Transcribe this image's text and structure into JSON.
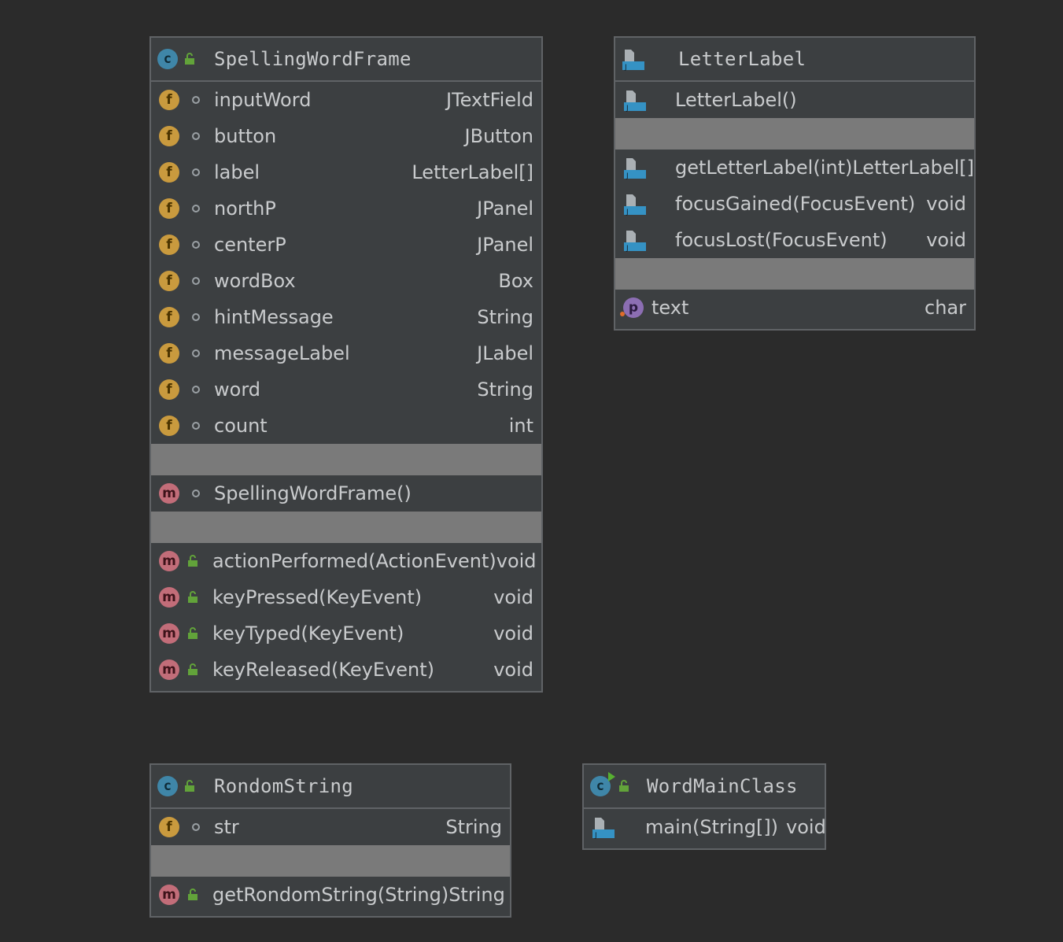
{
  "classes": {
    "spelling": {
      "name": "SpellingWordFrame",
      "fields": [
        {
          "name": "inputWord",
          "type": "JTextField"
        },
        {
          "name": "button",
          "type": "JButton"
        },
        {
          "name": "label",
          "type": "LetterLabel[]"
        },
        {
          "name": "northP",
          "type": "JPanel"
        },
        {
          "name": "centerP",
          "type": "JPanel"
        },
        {
          "name": "wordBox",
          "type": "Box"
        },
        {
          "name": "hintMessage",
          "type": "String"
        },
        {
          "name": "messageLabel",
          "type": "JLabel"
        },
        {
          "name": "word",
          "type": "String"
        },
        {
          "name": "count",
          "type": "int"
        }
      ],
      "constructor": "SpellingWordFrame()",
      "methods": [
        {
          "name": "actionPerformed(ActionEvent)",
          "type": "void"
        },
        {
          "name": "keyPressed(KeyEvent)",
          "type": "void"
        },
        {
          "name": "keyTyped(KeyEvent)",
          "type": "void"
        },
        {
          "name": "keyReleased(KeyEvent)",
          "type": "void"
        }
      ]
    },
    "letterlabel": {
      "name": "LetterLabel",
      "constructor": "LetterLabel()",
      "methods": [
        {
          "name": "getLetterLabel(int)",
          "type": "LetterLabel[]"
        },
        {
          "name": "focusGained(FocusEvent)",
          "type": "void"
        },
        {
          "name": "focusLost(FocusEvent)",
          "type": "void"
        }
      ],
      "property": {
        "name": "text",
        "type": "char"
      }
    },
    "rondom": {
      "name": "RondomString",
      "field": {
        "name": "str",
        "type": "String"
      },
      "method": {
        "name": "getRondomString(String)",
        "type": "String"
      }
    },
    "wordmain": {
      "name": "WordMainClass",
      "method": {
        "name": "main(String[])",
        "type": "void"
      }
    }
  },
  "icons": {
    "field": "field-icon",
    "method": "method-icon",
    "class": "class-icon",
    "property": "property-icon",
    "java_file": "java-source-icon",
    "public": "public-lock-icon",
    "package": "package-visibility-icon"
  },
  "icon_letters": {
    "field": "f",
    "method": "m",
    "class": "c",
    "property": "p"
  },
  "colors": {
    "background": "#2b2b2b",
    "box": "#3c3f41",
    "border": "#606366",
    "separator": "#7a7a7a",
    "field_icon": "#c99a3e",
    "method_icon": "#c26d79",
    "class_icon": "#3f86a8",
    "property_icon": "#8c6eb3",
    "public_lock": "#62a33a"
  }
}
